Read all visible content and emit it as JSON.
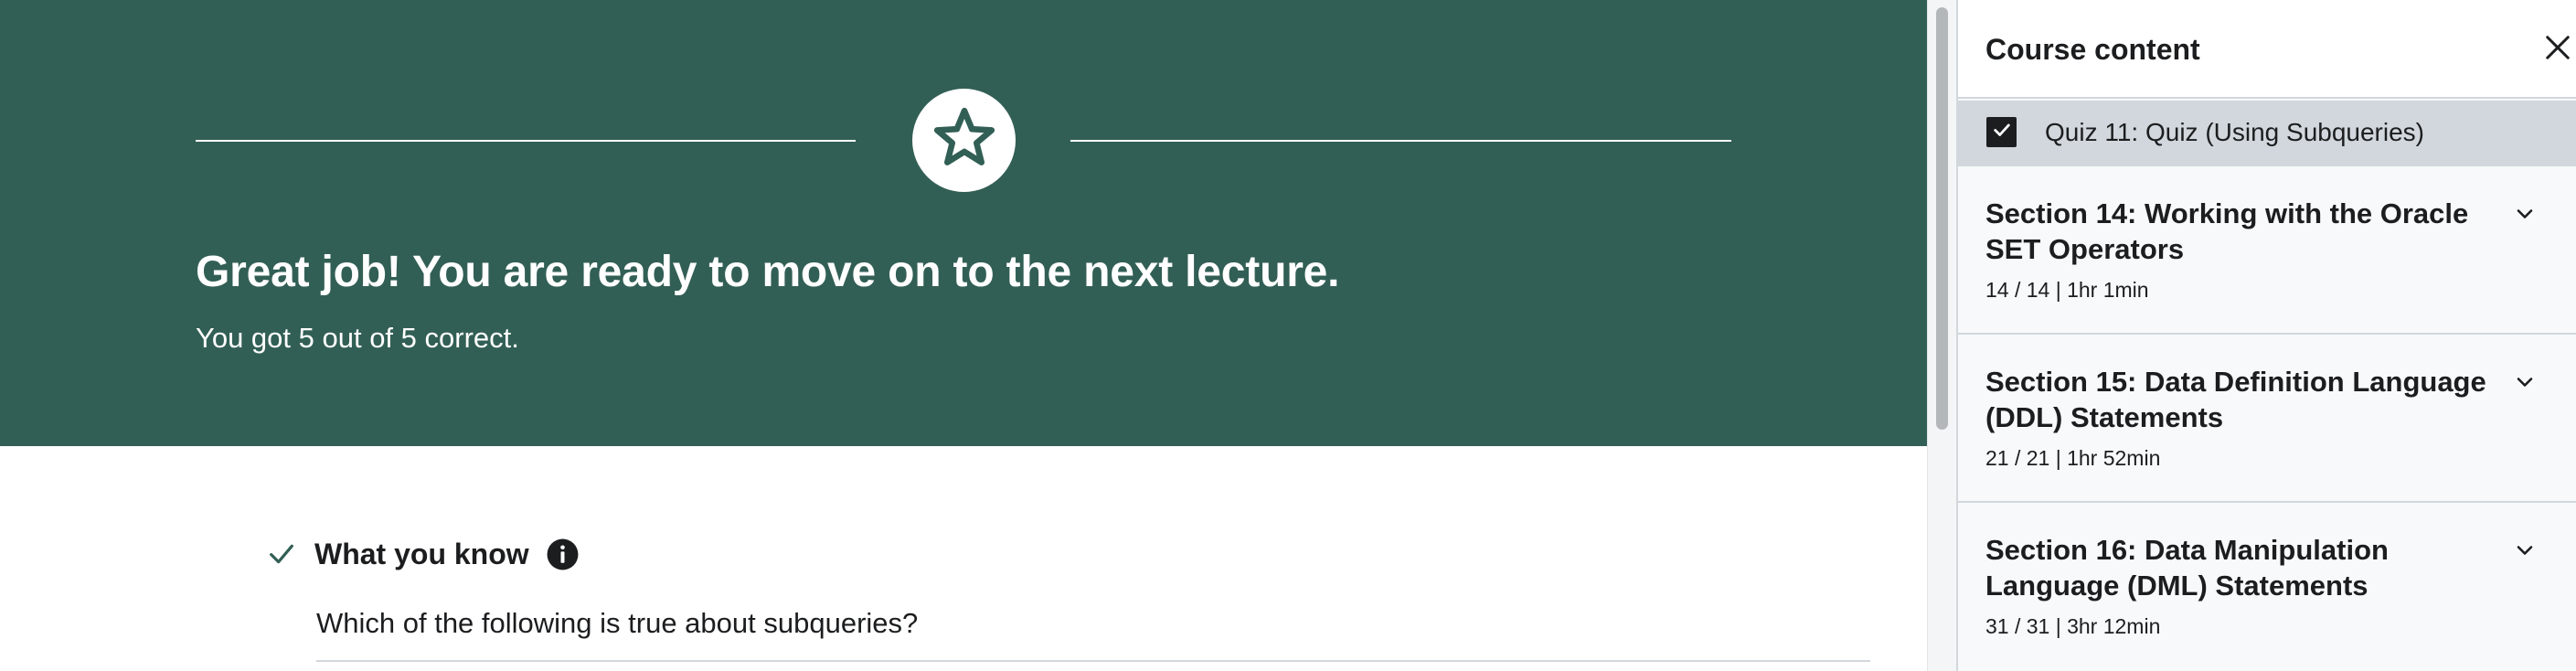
{
  "banner": {
    "title": "Great job! You are ready to move on to the next lecture.",
    "subtitle": "You got 5 out of 5 correct.",
    "badge_icon": "star-icon",
    "background_color": "#325f55"
  },
  "result": {
    "heading": "What you know",
    "question": "Which of the following is true about subqueries?"
  },
  "sidebar": {
    "title": "Course content",
    "current_item": {
      "label": "Quiz 11: Quiz (Using Subqueries)",
      "completed": true
    },
    "sections": [
      {
        "title": "Section 14: Working with the Oracle SET Operators",
        "meta": "14 / 14 | 1hr 1min"
      },
      {
        "title": "Section 15: Data Definition Language (DDL) Statements",
        "meta": "21 / 21 | 1hr 52min"
      },
      {
        "title": "Section 16: Data Manipulation Language (DML) Statements",
        "meta": "31 / 31 | 3hr 12min"
      }
    ]
  }
}
